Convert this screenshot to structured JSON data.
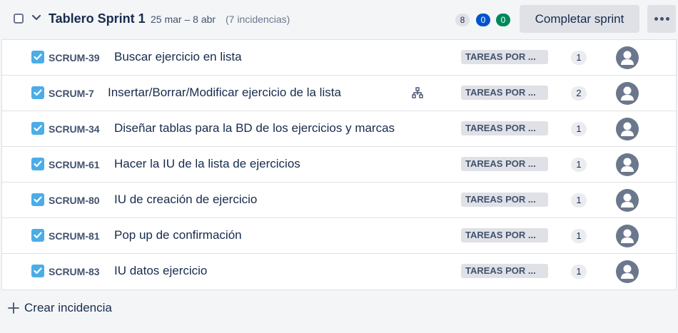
{
  "sprint": {
    "title": "Tablero Sprint 1",
    "dates": "25 mar – 8 abr",
    "issue_count": "(7 incidencias)",
    "counts": {
      "todo": "8",
      "in_progress": "0",
      "done": "0"
    },
    "complete_label": "Completar sprint"
  },
  "issues": [
    {
      "key": "SCRUM-39",
      "summary": "Buscar ejercicio en lista",
      "status": "TAREAS POR ...",
      "points": "1",
      "has_children": false
    },
    {
      "key": "SCRUM-7",
      "summary": "Insertar/Borrar/Modificar ejercicio de la lista",
      "status": "TAREAS POR ...",
      "points": "2",
      "has_children": true
    },
    {
      "key": "SCRUM-34",
      "summary": "Diseñar tablas para la BD de los ejercicios y marcas",
      "status": "TAREAS POR ...",
      "points": "1",
      "has_children": false
    },
    {
      "key": "SCRUM-61",
      "summary": "Hacer la IU de la lista de ejercicios",
      "status": "TAREAS POR ...",
      "points": "1",
      "has_children": false
    },
    {
      "key": "SCRUM-80",
      "summary": "IU de creación de ejercicio",
      "status": "TAREAS POR ...",
      "points": "1",
      "has_children": false
    },
    {
      "key": "SCRUM-81",
      "summary": "Pop up de confirmación",
      "status": "TAREAS POR ...",
      "points": "1",
      "has_children": false
    },
    {
      "key": "SCRUM-83",
      "summary": "IU datos ejercicio",
      "status": "TAREAS POR ...",
      "points": "1",
      "has_children": false
    }
  ],
  "create_label": "Crear incidencia",
  "icons": {
    "chevron": "chevron-down-icon",
    "more": "more-icon",
    "task": "checkbox-task-icon",
    "child": "child-issues-icon",
    "avatar": "avatar-icon",
    "plus": "plus-icon"
  },
  "colors": {
    "in_progress": "#0052cc",
    "done": "#00875a",
    "task": "#4bade8"
  }
}
